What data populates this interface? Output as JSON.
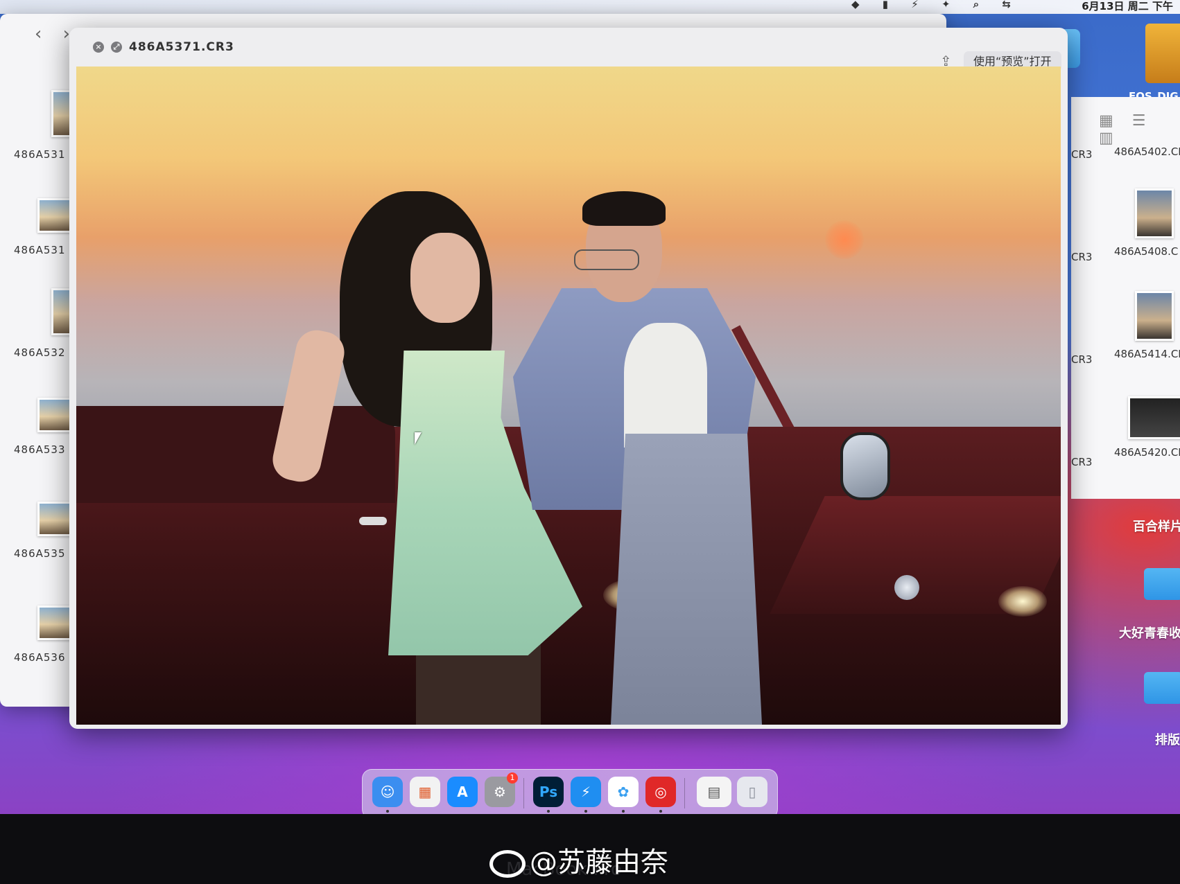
{
  "menubar": {
    "datetime": "6月13日 周二 下午",
    "status_icons": "◆ ▮ ⚡ ✦ ⌕ ⇆"
  },
  "finder_back": {
    "nav_back": "‹",
    "nav_forward": "›",
    "files": [
      "486A531",
      "486A531",
      "486A532",
      "486A533",
      "486A535",
      "486A536"
    ]
  },
  "finder_right": {
    "toolbar": "▦ ☰ ▥",
    "left_labels": [
      "CR3",
      "CR3",
      "CR3",
      "CR3"
    ],
    "files": [
      "486A5402.CI",
      "486A5408.C",
      "486A5414.CI",
      "486A5420.CI"
    ]
  },
  "desktop": {
    "eos_label": "EOS_DIG",
    "folders": [
      "百合样片",
      "大好青春收",
      "排版"
    ]
  },
  "quicklook": {
    "title": "486A5371.CR3",
    "close_glyph": "×",
    "fullscreen_glyph": "⤢",
    "share_glyph": "⇪",
    "open_with_label": "使用“预览”打开"
  },
  "dock": {
    "apps": [
      {
        "name": "Finder",
        "glyph": "☺"
      },
      {
        "name": "Launchpad",
        "glyph": "▦"
      },
      {
        "name": "App Store",
        "glyph": "A"
      },
      {
        "name": "System Settings",
        "glyph": "⚙"
      },
      {
        "name": "Photoshop",
        "glyph": "Ps"
      },
      {
        "name": "Thunder",
        "glyph": "⚡"
      },
      {
        "name": "Baidu Netdisk",
        "glyph": "✿"
      },
      {
        "name": "NetEase Music",
        "glyph": "◎"
      },
      {
        "name": "Preview",
        "glyph": "▤"
      },
      {
        "name": "Trash",
        "glyph": "▯"
      }
    ],
    "settings_badge": "1",
    "colors": {
      "finder": "#3b8ef0",
      "launchpad": "#f2f2f2",
      "appstore": "#1a8cff",
      "settings": "#9a9aa0",
      "photoshop": "#001e36",
      "thunder": "#1f8ef1",
      "netdisk": "#ffffff",
      "music": "#e02828",
      "preview": "#f4f4f4",
      "trash": "#e6e8ee"
    }
  },
  "watermark": "@苏藤由奈",
  "bezel_label": "MacBook Pro"
}
